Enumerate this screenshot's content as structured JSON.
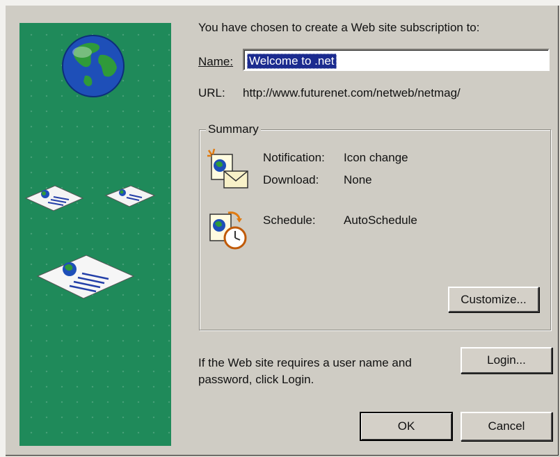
{
  "intro_text": "You have chosen to create a Web site subscription to:",
  "name_label": "Name:",
  "name_value": "Welcome to .net",
  "url_label": "URL:",
  "url_value": "http://www.futurenet.com/netweb/netmag/",
  "summary": {
    "legend": "Summary",
    "notification_label": "Notification:",
    "notification_value": "Icon change",
    "download_label": "Download:",
    "download_value": "None",
    "schedule_label": "Schedule:",
    "schedule_value": "AutoSchedule",
    "customize_label": "Customize..."
  },
  "login_prompt_line1": "If the Web site requires a user name and",
  "login_prompt_line2": "password, click Login.",
  "login_label": "Login...",
  "ok_label": "OK",
  "cancel_label": "Cancel",
  "colors": {
    "panel_green": "#1f8a5a",
    "selection_blue": "#1b2b8f",
    "face": "#d4d0c8"
  }
}
